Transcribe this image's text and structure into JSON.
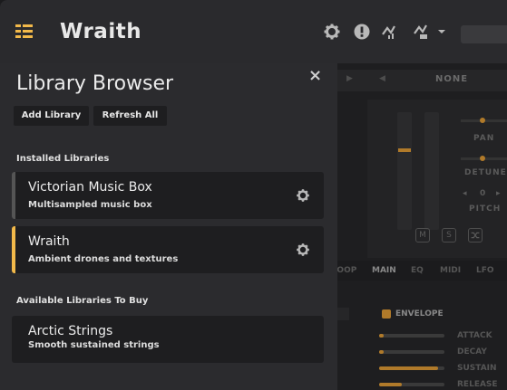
{
  "app": {
    "title": "Wraith"
  },
  "library_browser": {
    "title": "Library Browser",
    "close_label": "×",
    "buttons": {
      "add_library": "Add Library",
      "refresh_all": "Refresh All"
    },
    "installed_label": "Installed Libraries",
    "installed": [
      {
        "name": "Victorian Music Box",
        "description": "Multisampled music box",
        "accent": "#555555"
      },
      {
        "name": "Wraith",
        "description": "Ambient drones and textures",
        "accent": "#f2b94a"
      }
    ],
    "available_label": "Available Libraries To Buy",
    "available": [
      {
        "name": "Arctic Strings",
        "description": "Smooth sustained strings"
      }
    ]
  },
  "background": {
    "preset_name": "NONE",
    "labels": {
      "pan": "PAN",
      "detune": "DETUNE",
      "pitch_value": "0",
      "pitch": "PITCH"
    },
    "buttons": {
      "mute": "M",
      "solo": "S"
    },
    "tabs": [
      "LOOP",
      "MAIN",
      "EQ",
      "MIDI",
      "LFO"
    ],
    "envelope": {
      "title": "ENVELOPE",
      "params": [
        {
          "name": "ATTACK",
          "value": 0.05
        },
        {
          "name": "DECAY",
          "value": 0.05
        },
        {
          "name": "SUSTAIN",
          "value": 0.9
        },
        {
          "name": "RELEASE",
          "value": 0.35
        }
      ]
    }
  },
  "colors": {
    "accent": "#f2b94a",
    "panel": "#2b2b2e",
    "card": "#1e1e20"
  }
}
